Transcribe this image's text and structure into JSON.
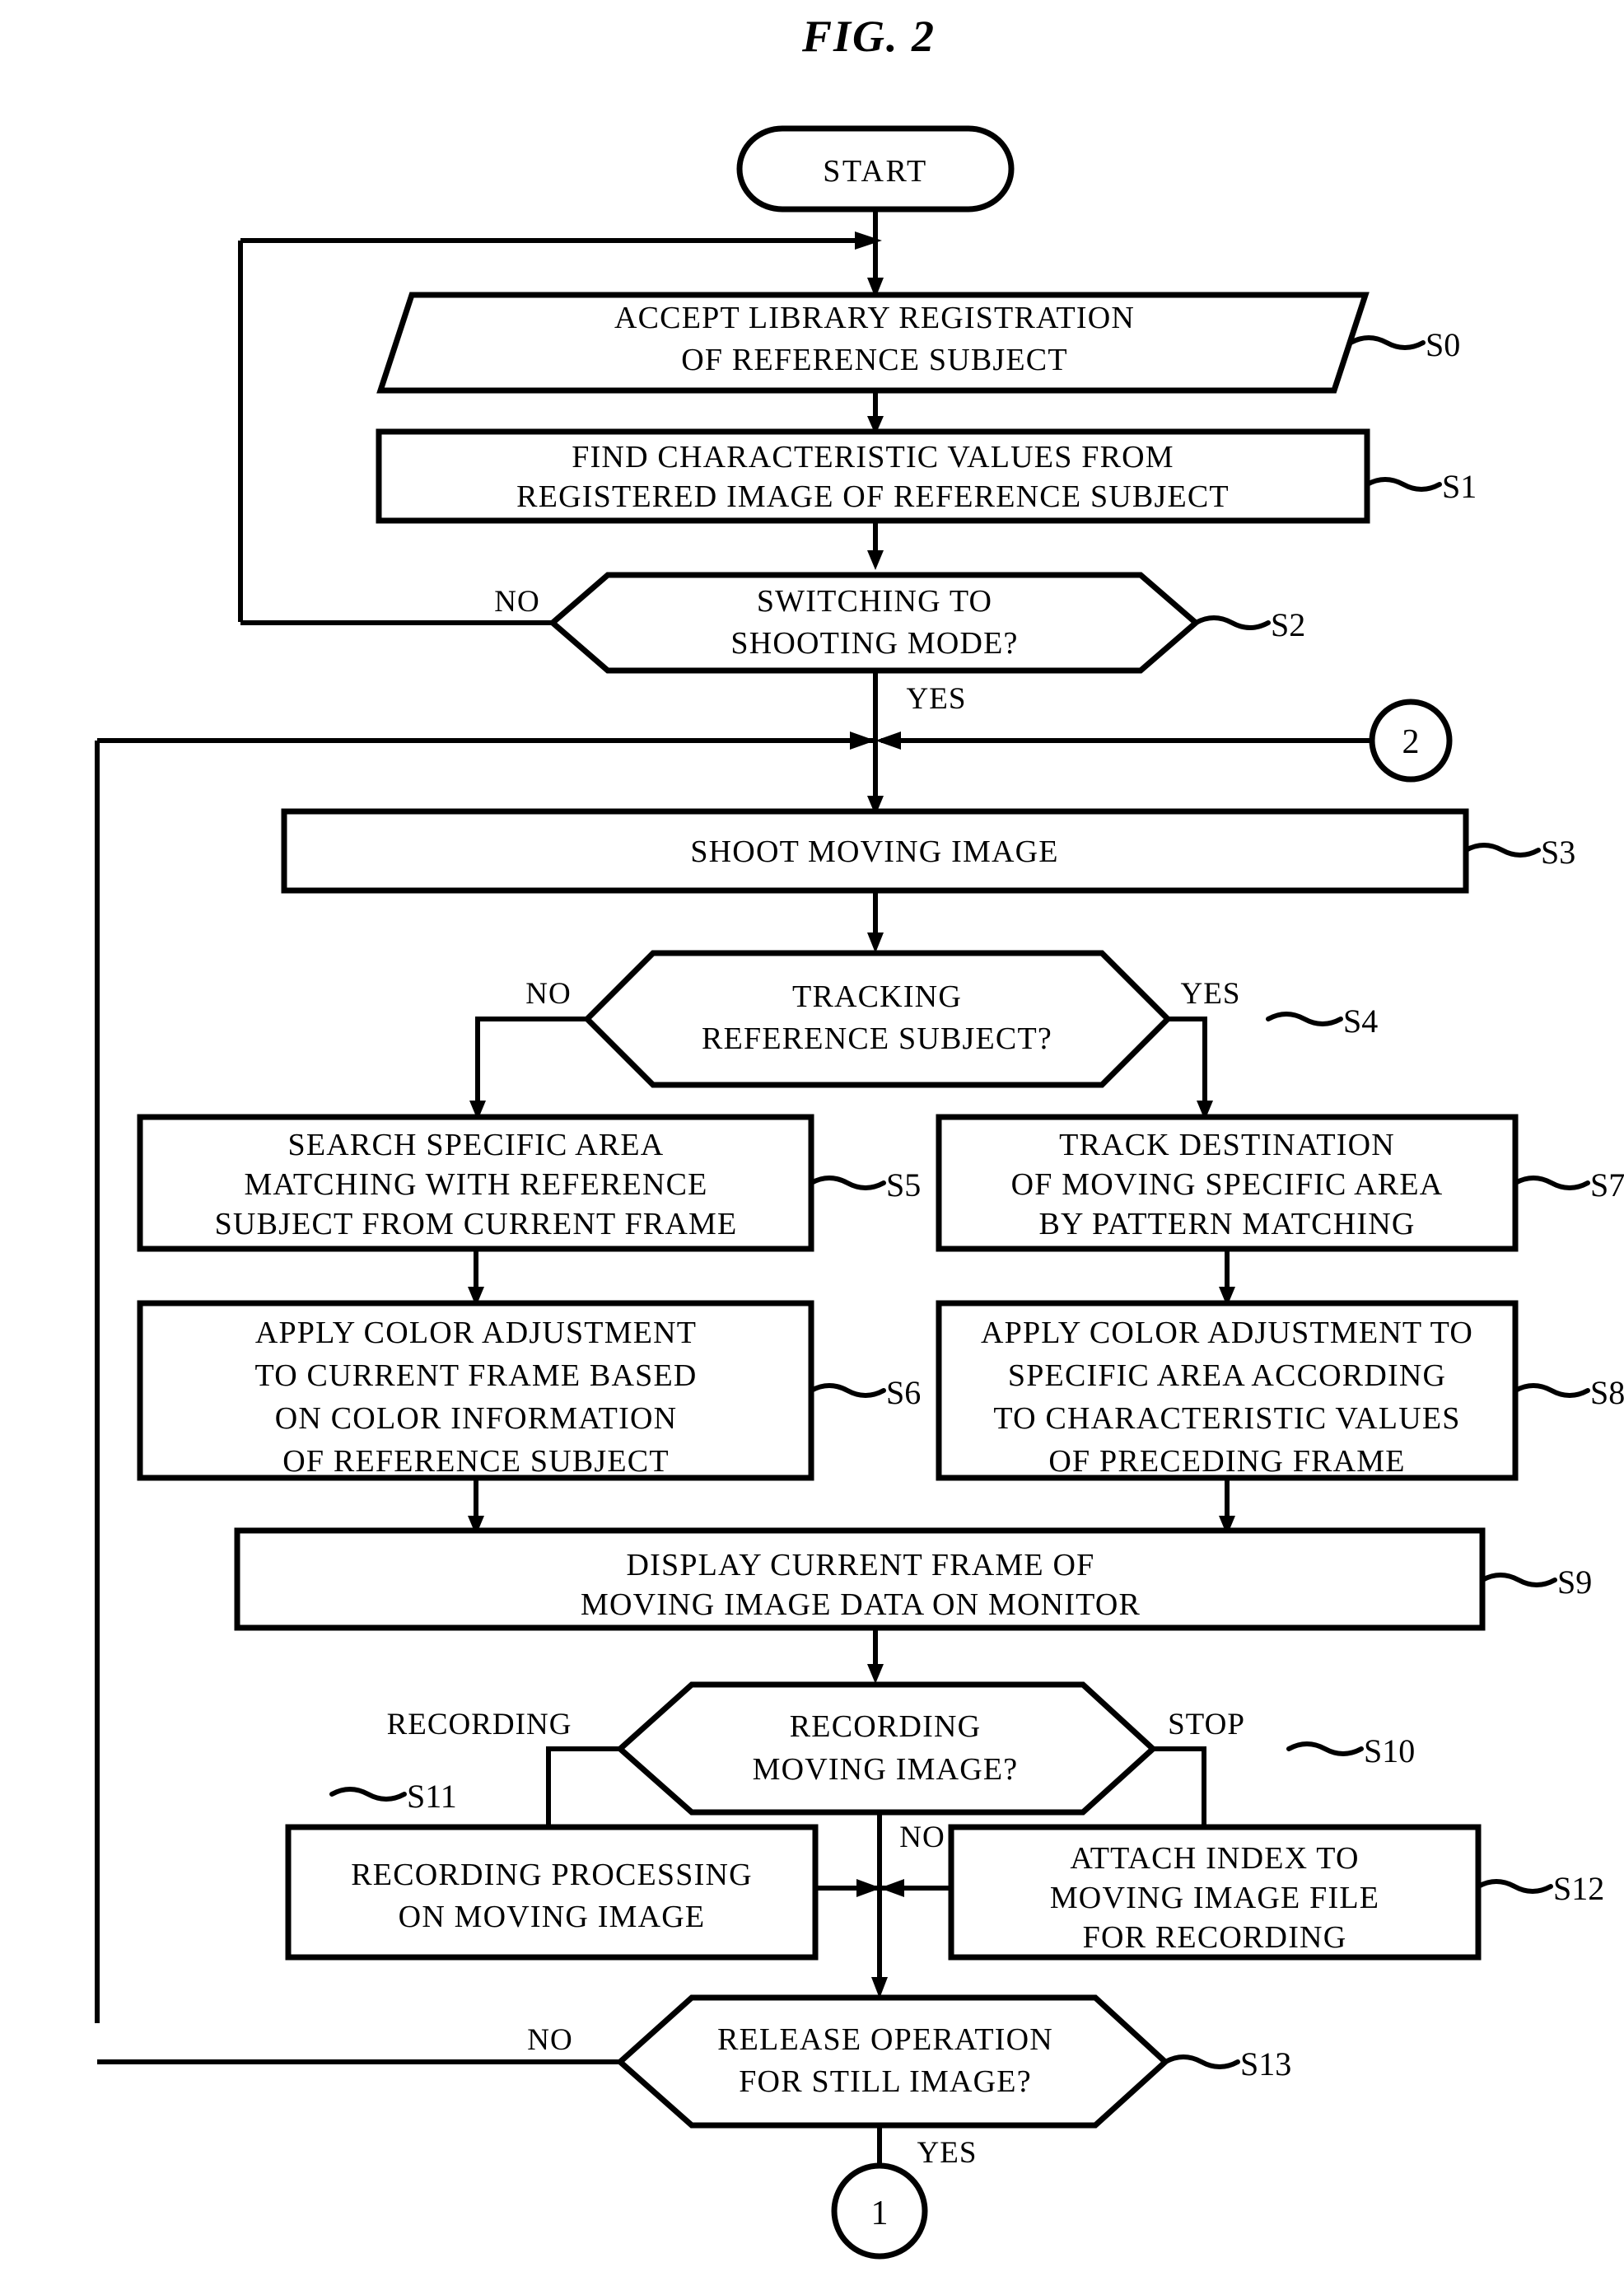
{
  "figure": {
    "title": "FIG. 2",
    "type": "patent-flowchart"
  },
  "terminals": {
    "start": "START",
    "connector_2": "2",
    "connector_1": "1"
  },
  "steps": [
    {
      "id": "S0",
      "label": "S0",
      "shape": "parallelogram",
      "lines": [
        "ACCEPT LIBRARY REGISTRATION",
        "OF REFERENCE SUBJECT"
      ]
    },
    {
      "id": "S1",
      "label": "S1",
      "shape": "rect",
      "lines": [
        "FIND CHARACTERISTIC VALUES FROM",
        "REGISTERED IMAGE OF REFERENCE SUBJECT"
      ]
    },
    {
      "id": "S2",
      "label": "S2",
      "shape": "decision",
      "lines": [
        "SWITCHING TO",
        "SHOOTING MODE?"
      ],
      "branches": {
        "no": "NO",
        "yes": "YES"
      }
    },
    {
      "id": "S3",
      "label": "S3",
      "shape": "rect",
      "lines": [
        "SHOOT MOVING IMAGE"
      ]
    },
    {
      "id": "S4",
      "label": "S4",
      "shape": "decision",
      "lines": [
        "TRACKING",
        "REFERENCE SUBJECT?"
      ],
      "branches": {
        "no": "NO",
        "yes": "YES"
      }
    },
    {
      "id": "S5",
      "label": "S5",
      "shape": "rect",
      "lines": [
        "SEARCH SPECIFIC AREA",
        "MATCHING WITH REFERENCE",
        "SUBJECT FROM CURRENT FRAME"
      ]
    },
    {
      "id": "S6",
      "label": "S6",
      "shape": "rect",
      "lines": [
        "APPLY COLOR ADJUSTMENT",
        "TO CURRENT FRAME BASED",
        "ON COLOR INFORMATION",
        "OF REFERENCE SUBJECT"
      ]
    },
    {
      "id": "S7",
      "label": "S7",
      "shape": "rect",
      "lines": [
        "TRACK DESTINATION",
        "OF MOVING SPECIFIC AREA",
        "BY PATTERN MATCHING"
      ]
    },
    {
      "id": "S8",
      "label": "S8",
      "shape": "rect",
      "lines": [
        "APPLY COLOR ADJUSTMENT TO",
        "SPECIFIC AREA ACCORDING",
        "TO CHARACTERISTIC VALUES",
        "OF PRECEDING FRAME"
      ]
    },
    {
      "id": "S9",
      "label": "S9",
      "shape": "rect",
      "lines": [
        "DISPLAY CURRENT FRAME OF",
        "MOVING IMAGE DATA ON MONITOR"
      ]
    },
    {
      "id": "S10",
      "label": "S10",
      "shape": "decision",
      "lines": [
        "RECORDING",
        "MOVING IMAGE?"
      ],
      "branches": {
        "left": "RECORDING",
        "right": "STOP",
        "down": "NO"
      }
    },
    {
      "id": "S11",
      "label": "S11",
      "shape": "rect",
      "lines": [
        "RECORDING PROCESSING",
        "ON MOVING IMAGE"
      ]
    },
    {
      "id": "S12",
      "label": "S12",
      "shape": "rect",
      "lines": [
        "ATTACH INDEX TO",
        "MOVING IMAGE FILE",
        "FOR RECORDING"
      ]
    },
    {
      "id": "S13",
      "label": "S13",
      "shape": "decision",
      "lines": [
        "RELEASE OPERATION",
        "FOR STILL IMAGE?"
      ],
      "branches": {
        "no": "NO",
        "yes": "YES"
      }
    }
  ],
  "colors": {
    "stroke": "#000000",
    "fill": "#ffffff",
    "background": "#ffffff"
  }
}
